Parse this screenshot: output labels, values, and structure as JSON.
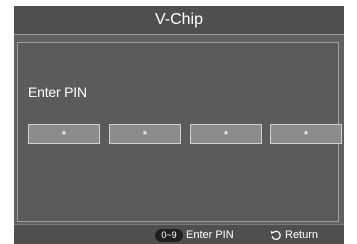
{
  "dialog": {
    "title": "V-Chip"
  },
  "pin_entry": {
    "label": "Enter PIN",
    "digits": [
      "*",
      "*",
      "*",
      "*"
    ]
  },
  "footer": {
    "key_badge": "0~9",
    "enter_pin_label": "Enter PIN",
    "return_icon": "return-arrow-icon",
    "return_label": "Return"
  },
  "colors": {
    "dialog_bg": "#616161",
    "title_bar_bg": "#4f4f4f",
    "pin_box_bg": "#8c8c8c",
    "text": "#ffffff"
  }
}
